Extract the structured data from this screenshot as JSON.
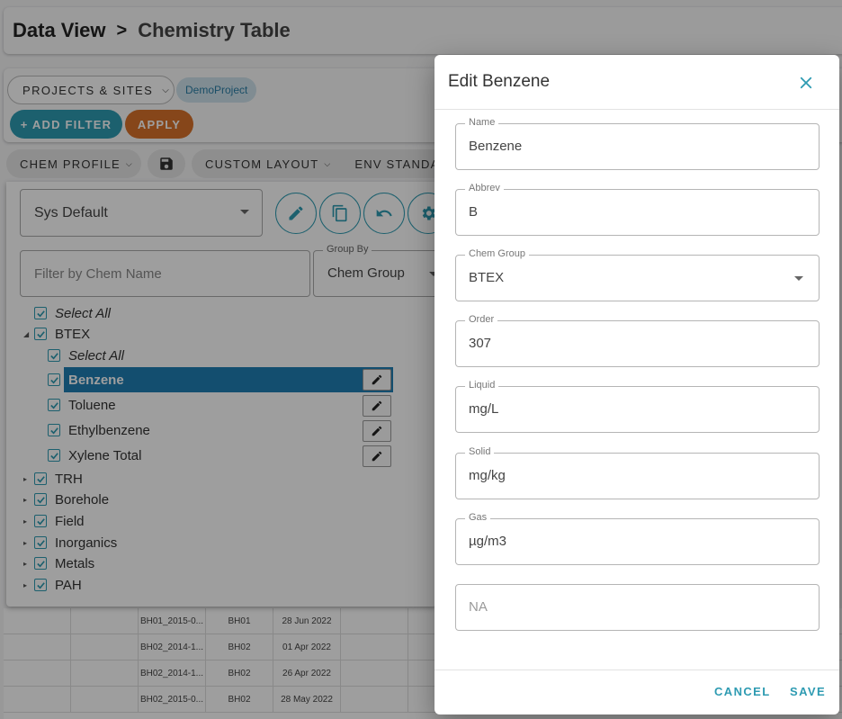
{
  "breadcrumb": {
    "root": "Data View",
    "separator": ">",
    "current": "Chemistry Table"
  },
  "filterbar": {
    "projects_label": "PROJECTS & SITES",
    "project_chip": "DemoProject",
    "add_filter_label": "+ ADD FILTER",
    "apply_label": "APPLY"
  },
  "tabbar": {
    "chem_profile_label": "CHEM PROFILE",
    "custom_layout_label": "CUSTOM LAYOUT",
    "env_standards_label": "ENV STANDA"
  },
  "chem_panel": {
    "profile_value": "Sys Default",
    "filter_placeholder": "Filter by Chem Name",
    "group_by_label": "Group By",
    "group_by_value": "Chem Group",
    "select_all": "Select All",
    "btex_group": "BTEX",
    "btex_select_all": "Select All",
    "items": {
      "benzene": "Benzene",
      "toluene": "Toluene",
      "ethylbenzene": "Ethylbenzene",
      "xylene": "Xylene Total"
    },
    "groups": {
      "trh": "TRH",
      "borehole": "Borehole",
      "field": "Field",
      "inorganics": "Inorganics",
      "metals": "Metals",
      "pah": "PAH"
    }
  },
  "grid_rows": [
    {
      "sample": "BH01_2015-0...",
      "location": "BH01",
      "date": "28 Jun 2022"
    },
    {
      "sample": "BH02_2014-1...",
      "location": "BH02",
      "date": "01 Apr 2022"
    },
    {
      "sample": "BH02_2014-1...",
      "location": "BH02",
      "date": "26 Apr 2022"
    },
    {
      "sample": "BH02_2015-0...",
      "location": "BH02",
      "date": "28 May 2022"
    }
  ],
  "dialog": {
    "title": "Edit Benzene",
    "fields": {
      "name": {
        "label": "Name",
        "value": "Benzene"
      },
      "abbrev": {
        "label": "Abbrev",
        "value": "B"
      },
      "chem_group": {
        "label": "Chem Group",
        "value": "BTEX"
      },
      "order": {
        "label": "Order",
        "value": "307"
      },
      "liquid": {
        "label": "Liquid",
        "value": "mg/L"
      },
      "solid": {
        "label": "Solid",
        "value": "mg/kg"
      },
      "gas": {
        "label": "Gas",
        "value": "µg/m3"
      },
      "na": {
        "placeholder": "NA"
      }
    },
    "cancel_label": "CANCEL",
    "save_label": "SAVE"
  },
  "colors": {
    "accent": "#2e9bb2",
    "apply": "#d9722a",
    "selection": "#1f7fb4",
    "chip_bg": "#cfe3ec"
  }
}
